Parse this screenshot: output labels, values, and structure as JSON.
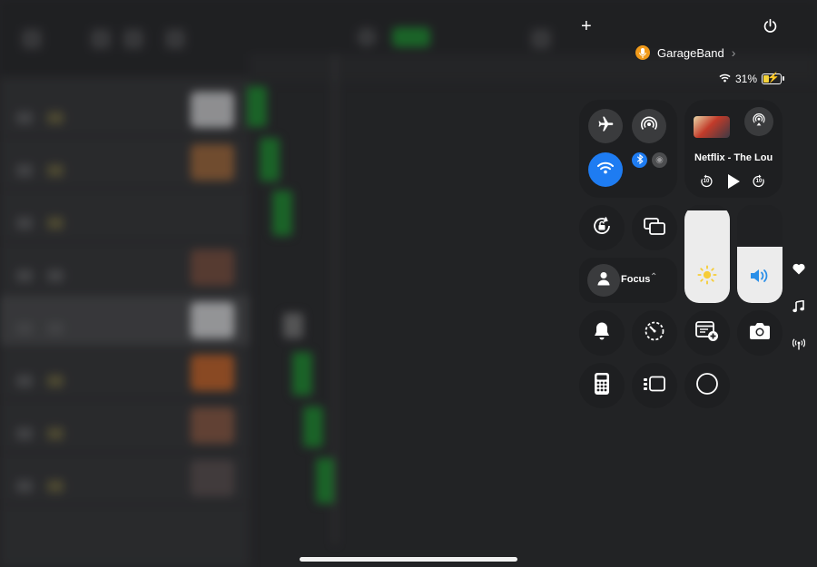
{
  "control_center": {
    "app_pill": {
      "name": "GarageBand"
    },
    "status": {
      "battery_percent": "31%"
    },
    "now_playing": {
      "title": "Netflix - The Lou",
      "skip_back": "10",
      "skip_forward": "10"
    },
    "focus": {
      "label": "Focus"
    },
    "sliders": {
      "brightness_level": 0.94,
      "volume_level": 0.57
    },
    "connectivity": {
      "airplane": false,
      "wifi": true,
      "bluetooth": true
    },
    "icons": {
      "add": "plus-icon",
      "power": "power-icon",
      "mic": "microphone-icon",
      "airplane": "airplane-icon",
      "airdrop": "airdrop-icon",
      "wifi": "wifi-icon",
      "bluetooth": "bluetooth-icon",
      "cellular": "cellular-icon",
      "airplay": "airplay-icon",
      "rotation_lock": "rotation-lock-icon",
      "screen_mirroring": "screen-mirroring-icon",
      "person": "person-icon",
      "brightness": "sun-icon",
      "volume": "speaker-icon",
      "bell": "bell-icon",
      "timer": "timer-icon",
      "note": "quick-note-icon",
      "camera": "camera-icon",
      "calculator": "calculator-icon",
      "stage_manager": "stage-manager-icon",
      "screen_record": "screen-record-icon",
      "favorites": "heart-icon",
      "music": "music-note-icon",
      "connectivity": "antenna-icon"
    },
    "colors": {
      "accent": "#1e7cf2",
      "mic_badge": "#f09a1a",
      "battery": "#f4d33a"
    }
  }
}
